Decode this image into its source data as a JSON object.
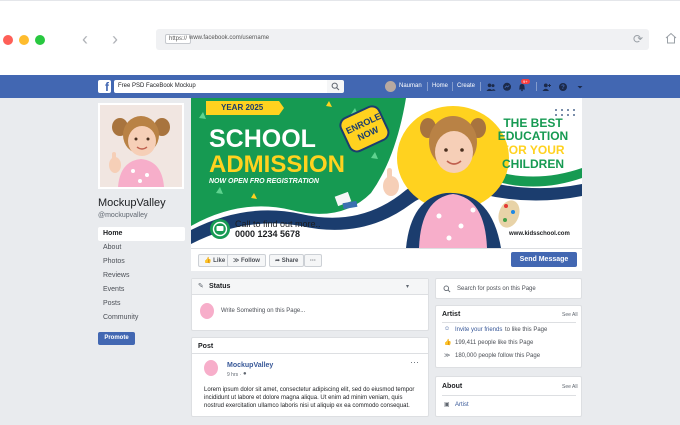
{
  "browser": {
    "url_protocol": "https://",
    "url": "www.facebook.com/username"
  },
  "fb_bar": {
    "search_value": "Free PSD FaceBook Mockup",
    "user_name": "Nauman",
    "home_label": "Home",
    "create_label": "Create",
    "notification_count": "9+"
  },
  "profile": {
    "name": "MockupValley",
    "handle": "@mockupvalley",
    "nav": [
      "Home",
      "About",
      "Photos",
      "Reviews",
      "Events",
      "Posts",
      "Community"
    ],
    "promote_label": "Promote"
  },
  "cover": {
    "year_label": "YEAR 2025",
    "headline_1": "SCHOOL",
    "headline_2": "ADMISSION",
    "subline": "NOW OPEN FRO REGISTRATION",
    "badge_1": "ENROLE",
    "badge_2": "NOW",
    "call_text": "Call to find out more..",
    "phone": "0000 1234 5678",
    "right_1": "THE BEST",
    "right_2": "EDUCATION",
    "right_3": "FOR YOUR",
    "right_4": "CHILDREN",
    "website": "www.kidsschool.com"
  },
  "actions": {
    "like": "Like",
    "follow": "Follow",
    "share": "Share",
    "more": "···",
    "send_message": "Send Message"
  },
  "status_card": {
    "title": "Status",
    "placeholder": "Write Something on this Page..."
  },
  "post_card": {
    "title": "Post",
    "author": "MockupValley",
    "time": "9 hrs ·",
    "body": "Lorem ipsum dolor sit amet, consectetur adipiscing elit, sed do eiusmod tempor incididunt ut labore et dolore magna aliqua. Ut enim ad minim veniam, quis nostrud exercitation ullamco laboris nisi ut aliquip ex ea commodo consequat."
  },
  "right_search": {
    "placeholder": "Search for posts on this Page"
  },
  "artist_card": {
    "title": "Artist",
    "see_all": "See All",
    "invite_link": "Invite your friends",
    "invite_rest": "to like this Page",
    "likes": "199,411 people like this Page",
    "follows": "180,000 people follow this Page"
  },
  "about_card": {
    "title": "About",
    "see_all": "See All",
    "item": "Artist"
  },
  "colors": {
    "fb_blue": "#4267b2",
    "cover_green": "#169a52",
    "cover_yellow": "#ffd21f",
    "cover_navy": "#1b3d6e"
  }
}
